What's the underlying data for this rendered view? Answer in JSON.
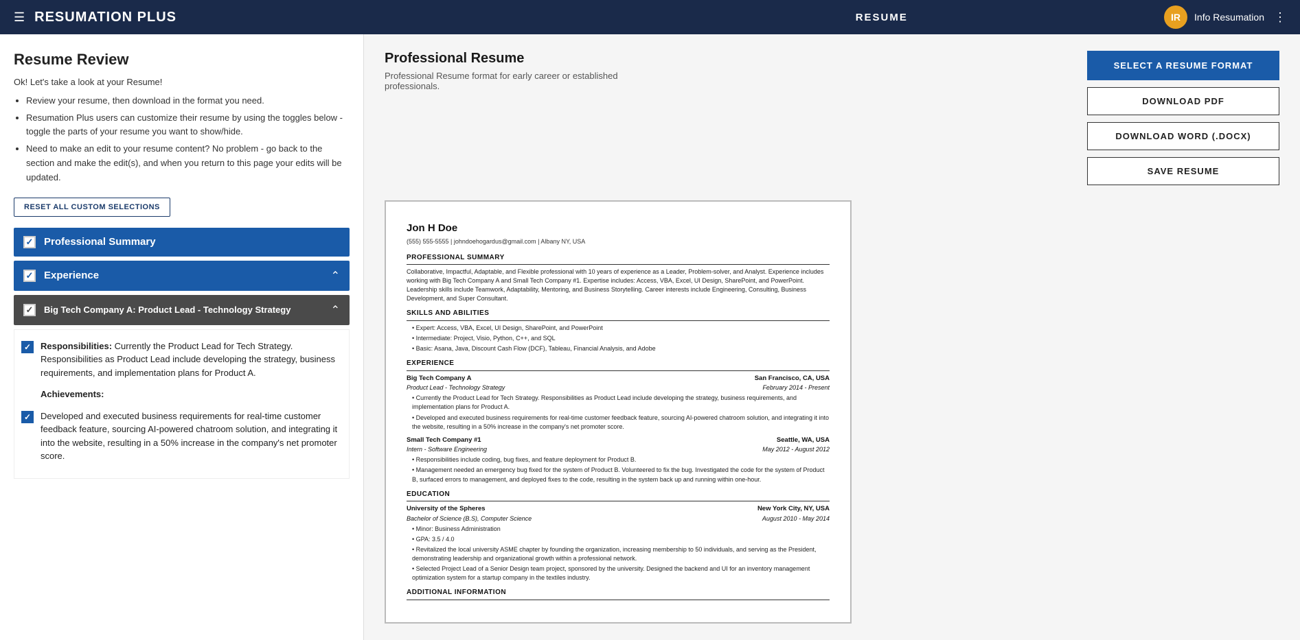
{
  "navbar": {
    "menu_icon": "☰",
    "brand": "RESUMATION PLUS",
    "center_label": "RESUME",
    "avatar_initials": "IR",
    "username": "Info Resumation",
    "dots": "⋮"
  },
  "left": {
    "page_title": "Resume Review",
    "intro": "Ok! Let's take a look at your Resume!",
    "bullets": [
      "Review your resume, then download in the format you need.",
      "Resumation Plus users can customize their resume by using the toggles below - toggle the parts of your resume you want to show/hide.",
      "Need to make an edit to your resume content? No problem - go back to the section and make the edit(s), and when you return to this page your edits will be updated."
    ],
    "reset_label": "RESET ALL CUSTOM SELECTIONS",
    "sections": [
      {
        "label": "Professional Summary",
        "checked": true,
        "expanded": false
      },
      {
        "label": "Experience",
        "checked": true,
        "expanded": true
      }
    ],
    "sub_section": {
      "label": "Big Tech Company A: Product Lead - Technology Strategy",
      "checked": true,
      "expanded": true
    },
    "responsibilities": {
      "header": "Responsibilities:",
      "text": "Currently the Product Lead for Tech Strategy. Responsibilities as Product Lead include developing the strategy, business requirements, and implementation plans for Product A.",
      "checked": true
    },
    "achievements_header": "Achievements:",
    "achievements_checked": true,
    "achievement_item": {
      "text": "Developed and executed business requirements for real-time customer feedback feature, sourcing AI-powered chatroom solution, and integrating it into the website, resulting in a 50% increase in the company's net promoter score.",
      "checked": true
    }
  },
  "right": {
    "resume_title": "Professional Resume",
    "resume_desc": "Professional Resume format for early career or established professionals.",
    "select_format_label": "SELECT A RESUME FORMAT",
    "download_pdf_label": "DOWNLOAD PDF",
    "download_word_label": "DOWNLOAD WORD (.DOCX)",
    "save_label": "SAVE RESUME",
    "preview": {
      "name": "Jon H Doe",
      "contact": "(555) 555-5555 | johndoehogardus@gmail.com | Albany NY, USA",
      "prof_summary_title": "PROFESSIONAL SUMMARY",
      "prof_summary": "Collaborative, Impactful, Adaptable, and Flexible professional with 10 years of experience as a Leader, Problem-solver, and Analyst. Experience includes working with Big Tech Company A and Small Tech Company #1. Expertise includes: Access, VBA, Excel, UI Design, SharePoint, and PowerPoint. Leadership skills include Teamwork, Adaptability, Mentoring, and Business Storytelling. Career interests include Engineering, Consulting, Business Development, and Super Consultant.",
      "skills_title": "SKILLS AND ABILITIES",
      "skills": [
        "Expert: Access, VBA, Excel, UI Design, SharePoint, and PowerPoint",
        "Intermediate: Project, Visio, Python, C++, and SQL",
        "Basic: Asana, Java, Discount Cash Flow (DCF), Tableau, Financial Analysis, and Adobe"
      ],
      "experience_title": "EXPERIENCE",
      "jobs": [
        {
          "company": "Big Tech Company A",
          "location": "San Francisco, CA, USA",
          "role": "Product Lead - Technology Strategy",
          "dates": "February 2014 - Present",
          "bullets": [
            "Currently the Product Lead for Tech Strategy. Responsibilities as Product Lead include developing the strategy, business requirements, and implementation plans for Product A.",
            "Developed and executed business requirements for real-time customer feedback feature, sourcing AI-powered chatroom solution, and integrating it into the website, resulting in a 50% increase in the company's net promoter score."
          ]
        },
        {
          "company": "Small Tech Company #1",
          "location": "Seattle, WA, USA",
          "role": "Intern - Software Engineering",
          "dates": "May 2012 - August 2012",
          "bullets": [
            "Responsibilities include coding, bug fixes, and feature deployment for Product B.",
            "Management needed an emergency bug fixed for the system of Product B. Volunteered to fix the bug. Investigated the code for the system of Product B, surfaced errors to management, and deployed fixes to the code, resulting in the system back up and running within one-hour."
          ]
        }
      ],
      "education_title": "EDUCATION",
      "schools": [
        {
          "name": "University of the Spheres",
          "location": "New York City, NY, USA",
          "degree": "Bachelor of Science (B.S), Computer Science",
          "dates": "August 2010 - May 2014",
          "bullets": [
            "Minor: Business Administration",
            "GPA: 3.5 / 4.0",
            "Revitalized the local university ASME chapter by founding the organization, increasing membership to 50 individuals, and serving as the President, demonstrating leadership and organizational growth within a professional network.",
            "Selected Project Lead of a Senior Design team project, sponsored by the university. Designed the backend and UI for an inventory management optimization system for a startup company in the textiles industry."
          ]
        }
      ],
      "additional_title": "ADDITIONAL INFORMATION"
    }
  }
}
